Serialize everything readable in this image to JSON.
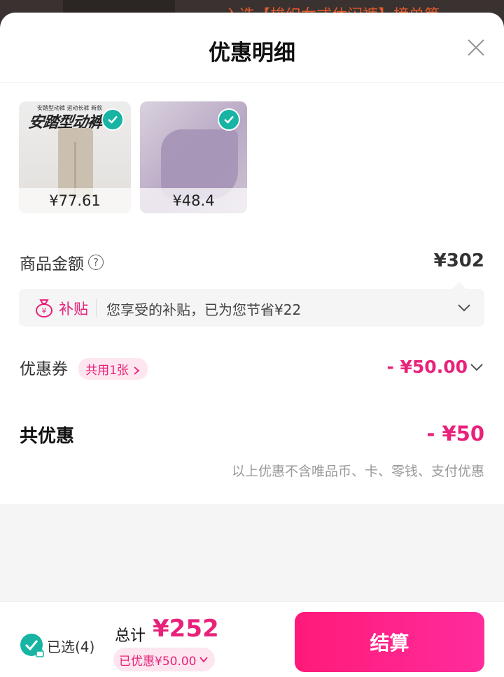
{
  "background": {
    "banner_text": "入选【梭织女式休闲裤】榜单第"
  },
  "sheet": {
    "title": "优惠明细",
    "close_icon": "close-icon"
  },
  "items": [
    {
      "image_text": "安踏型动裤",
      "image_small_text": "安踏型动裤 运动长裤 新款",
      "price": "¥77.61",
      "selected": true
    },
    {
      "price": "¥48.4",
      "selected": true
    }
  ],
  "goods_amount": {
    "label": "商品金额",
    "help": "?",
    "value": "¥302"
  },
  "subsidy": {
    "tag": "补贴",
    "text": "您享受的补贴，已为您节省¥22"
  },
  "coupon": {
    "label": "优惠券",
    "badge": "共用1张",
    "value": "- ¥50.00"
  },
  "total_discount": {
    "label": "共优惠",
    "value": "- ¥50",
    "note": "以上优惠不含唯品币、卡、零钱、支付优惠"
  },
  "bottom": {
    "selected_text": "已选(4)",
    "sum_label": "总计",
    "sum_value": "¥252",
    "saved_text": "已优惠¥50.00",
    "checkout_label": "结算"
  },
  "colors": {
    "accent": "#e8227a",
    "check": "#17b4a4"
  }
}
